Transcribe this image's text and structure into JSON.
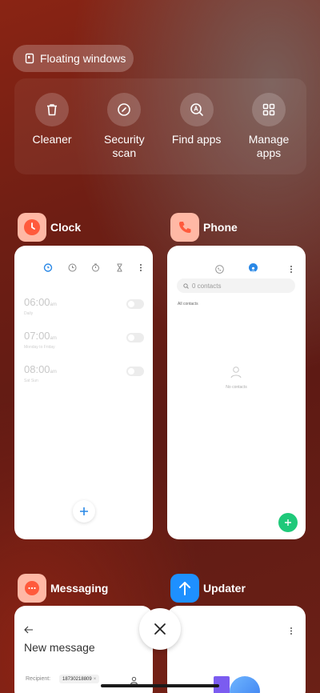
{
  "floating_windows": {
    "label": "Floating windows"
  },
  "tools": [
    {
      "label": "Cleaner",
      "icon": "trash-icon"
    },
    {
      "label": "Security\nscan",
      "icon": "shield-scan-icon"
    },
    {
      "label": "Find apps",
      "icon": "search-a-icon"
    },
    {
      "label": "Manage\napps",
      "icon": "grid-icon"
    }
  ],
  "clock": {
    "name": "Clock",
    "icon_color": "#ff5a3c",
    "alarms": [
      {
        "time": "06:00",
        "suffix": "am",
        "repeat": "Daily"
      },
      {
        "time": "07:00",
        "suffix": "am",
        "repeat": "Monday to Friday"
      },
      {
        "time": "08:00",
        "suffix": "am",
        "repeat": "Sat Sun"
      }
    ]
  },
  "phone": {
    "name": "Phone",
    "icon_color": "#ff6a4d",
    "search_placeholder": "0 contacts",
    "section_label": "All contacts",
    "empty_label": "No contacts",
    "fab_color": "#1fc97a"
  },
  "messaging": {
    "name": "Messaging",
    "icon_color": "#ff6a4d",
    "title": "New message",
    "recipient_label": "Recipient:",
    "recipient_chip": "18730218809"
  },
  "updater": {
    "name": "Updater",
    "icon_color": "#1e90ff"
  },
  "accent": "#2a88e6"
}
